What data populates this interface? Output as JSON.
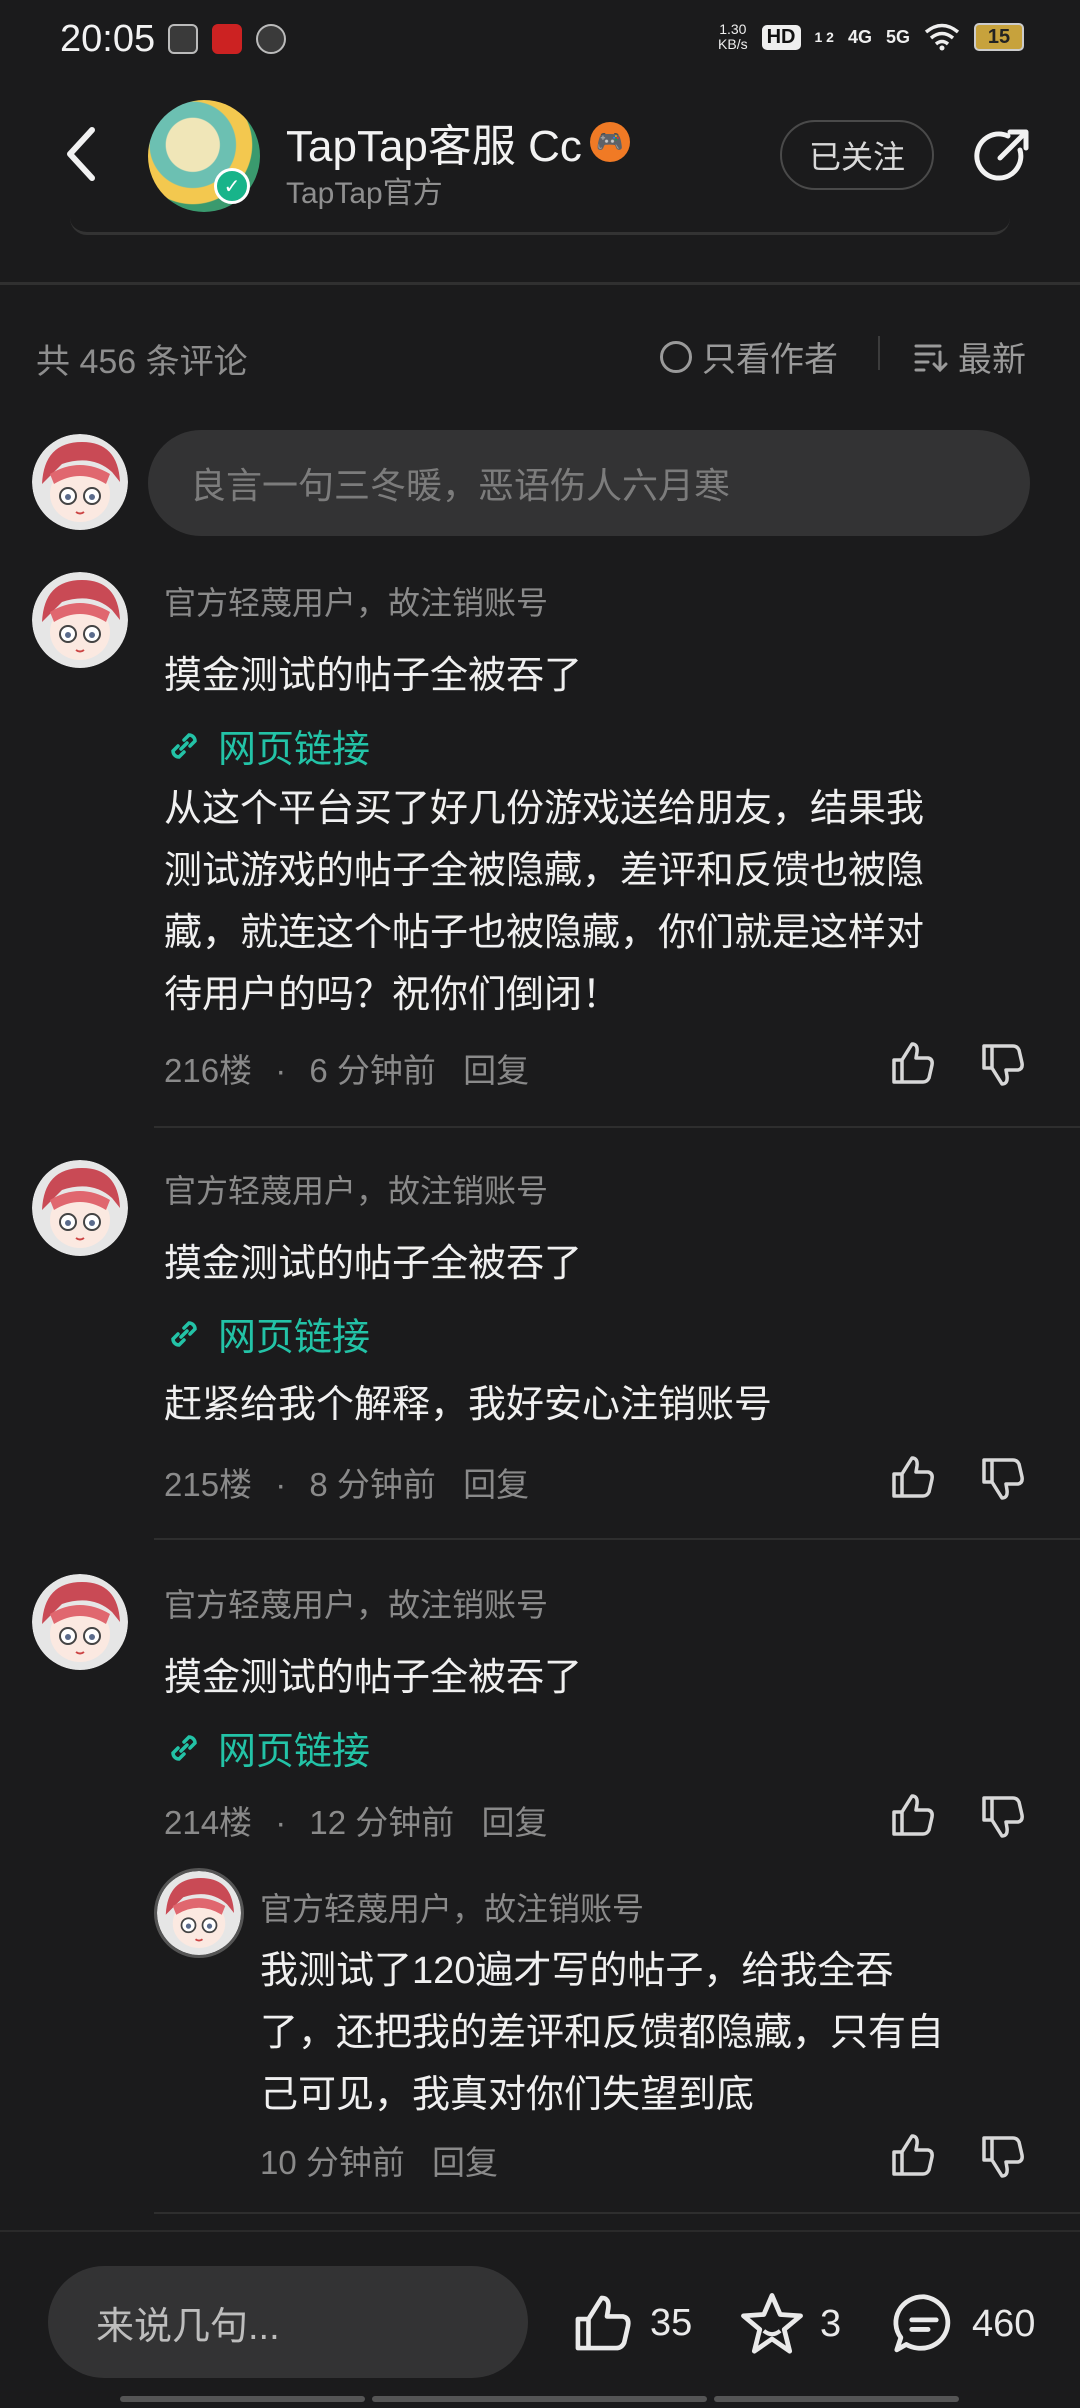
{
  "status": {
    "time": "20:05",
    "net_speed_value": "1.30",
    "net_speed_unit": "KB/s",
    "hd": "HD",
    "hd_sub": "1 2",
    "sig1": "4G",
    "sig2": "5G",
    "battery": "15"
  },
  "header": {
    "username": "TapTap客服 Cc",
    "subtitle": "TapTap官方",
    "follow_label": "已关注"
  },
  "comments_bar": {
    "count": "共 456 条评论",
    "author_only": "只看作者",
    "sort": "最新"
  },
  "comment_input": {
    "placeholder": "良言一句三冬暖，恶语伤人六月寒"
  },
  "comments": [
    {
      "name": "官方轻蔑用户，故注销账号",
      "title": "摸金测试的帖子全被吞了",
      "link": "网页链接",
      "body_lines": [
        "从这个平台买了好几份游戏送给朋友，结果我",
        "测试游戏的帖子全被隐藏，差评和反馈也被隐",
        "藏，就连这个帖子也被隐藏，你们就是这样对",
        "待用户的吗？祝你们倒闭！"
      ],
      "floor": "216楼",
      "time": "6 分钟前",
      "reply": "回复"
    },
    {
      "name": "官方轻蔑用户，故注销账号",
      "title": "摸金测试的帖子全被吞了",
      "link": "网页链接",
      "body_lines": [
        "赶紧给我个解释，我好安心注销账号"
      ],
      "floor": "215楼",
      "time": "8 分钟前",
      "reply": "回复"
    },
    {
      "name": "官方轻蔑用户，故注销账号",
      "title": "摸金测试的帖子全被吞了",
      "link": "网页链接",
      "floor": "214楼",
      "time": "12 分钟前",
      "reply": "回复",
      "sub_reply": {
        "name": "官方轻蔑用户，故注销账号",
        "body_lines": [
          "我测试了120遍才写的帖子，给我全吞",
          "了，还把我的差评和反馈都隐藏，只有自",
          "己可见，我真对你们失望到底"
        ],
        "time": "10 分钟前",
        "reply": "回复"
      }
    }
  ],
  "bottom": {
    "input_placeholder": "来说几句...",
    "likes": "35",
    "favorites": "3",
    "comments": "460"
  },
  "icons": {
    "back": "back-arrow-icon",
    "share": "share-icon",
    "like": "thumbs-up-icon",
    "dislike": "thumbs-down-icon",
    "link": "link-icon",
    "star": "star-icon",
    "chat": "chat-icon"
  },
  "colors": {
    "background": "#1b1b1c",
    "link": "#23c3a7",
    "badge": "#f07a25",
    "verify": "#18b48a"
  }
}
